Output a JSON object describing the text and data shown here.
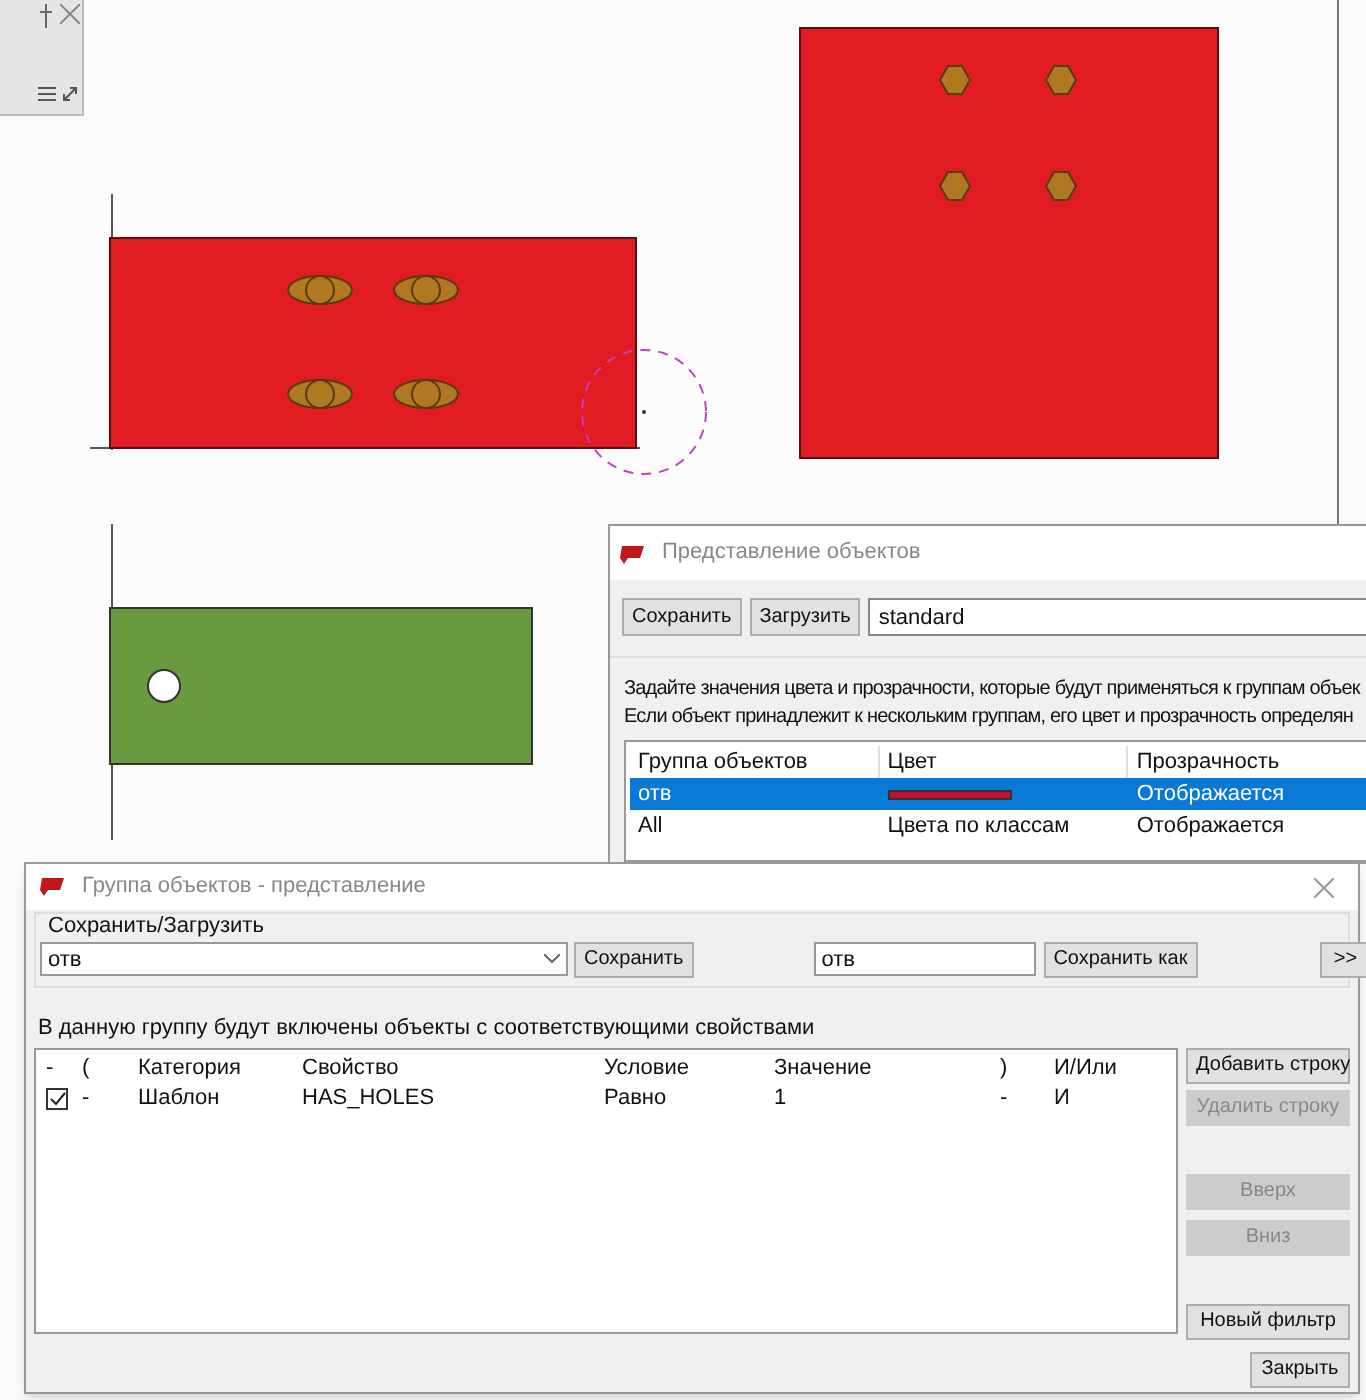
{
  "object_view_dialog": {
    "title": "Представление объектов",
    "toolbar": {
      "save_button": "Сохранить",
      "load_button": "Загрузить",
      "preset_field": "standard"
    },
    "description": [
      "Задайте значения цвета и прозрачности, которые будут применяться к группам объек",
      "Если объект принадлежит к нескольким группам, его цвет и прозрачность определян"
    ],
    "table": {
      "columns": [
        "Группа объектов",
        "Цвет",
        "Прозрачность"
      ],
      "rows": [
        {
          "group": "отв",
          "kind": "swatch",
          "color": "#c8102e",
          "transparency": "Отображается",
          "selected": true
        },
        {
          "group": "All",
          "kind": "text",
          "color_text": "Цвета по классам",
          "transparency": "Отображается",
          "selected": false
        }
      ]
    }
  },
  "group_dialog": {
    "title": "Группа объектов - представление",
    "save_load": {
      "legend": "Сохранить/Загрузить",
      "combo_value": "отв",
      "save_button": "Сохранить",
      "name_field": "отв",
      "save_as_button": "Сохранить как",
      "more_button": ">>"
    },
    "description": "В данную группу будут включены объекты с соответствующими свойствами",
    "table": {
      "columns": [
        "-",
        "(",
        "Категория",
        "Свойство",
        "Условие",
        "Значение",
        ")",
        "И/Или"
      ],
      "rows": [
        {
          "cells": [
            {
              "kind": "checkbox",
              "checked": true
            },
            "-",
            "Шаблон",
            "HAS_HOLES",
            "Равно",
            "1",
            "-",
            "И"
          ]
        }
      ]
    },
    "side_buttons": [
      {
        "label": "Добавить строку",
        "disabled": false
      },
      {
        "label": "Удалить строку",
        "disabled": true
      },
      {
        "label": "Вверх",
        "disabled": true
      },
      {
        "label": "Вниз",
        "disabled": true
      },
      {
        "label": "Новый фильтр",
        "disabled": false
      }
    ],
    "close_button": "Закрыть"
  }
}
